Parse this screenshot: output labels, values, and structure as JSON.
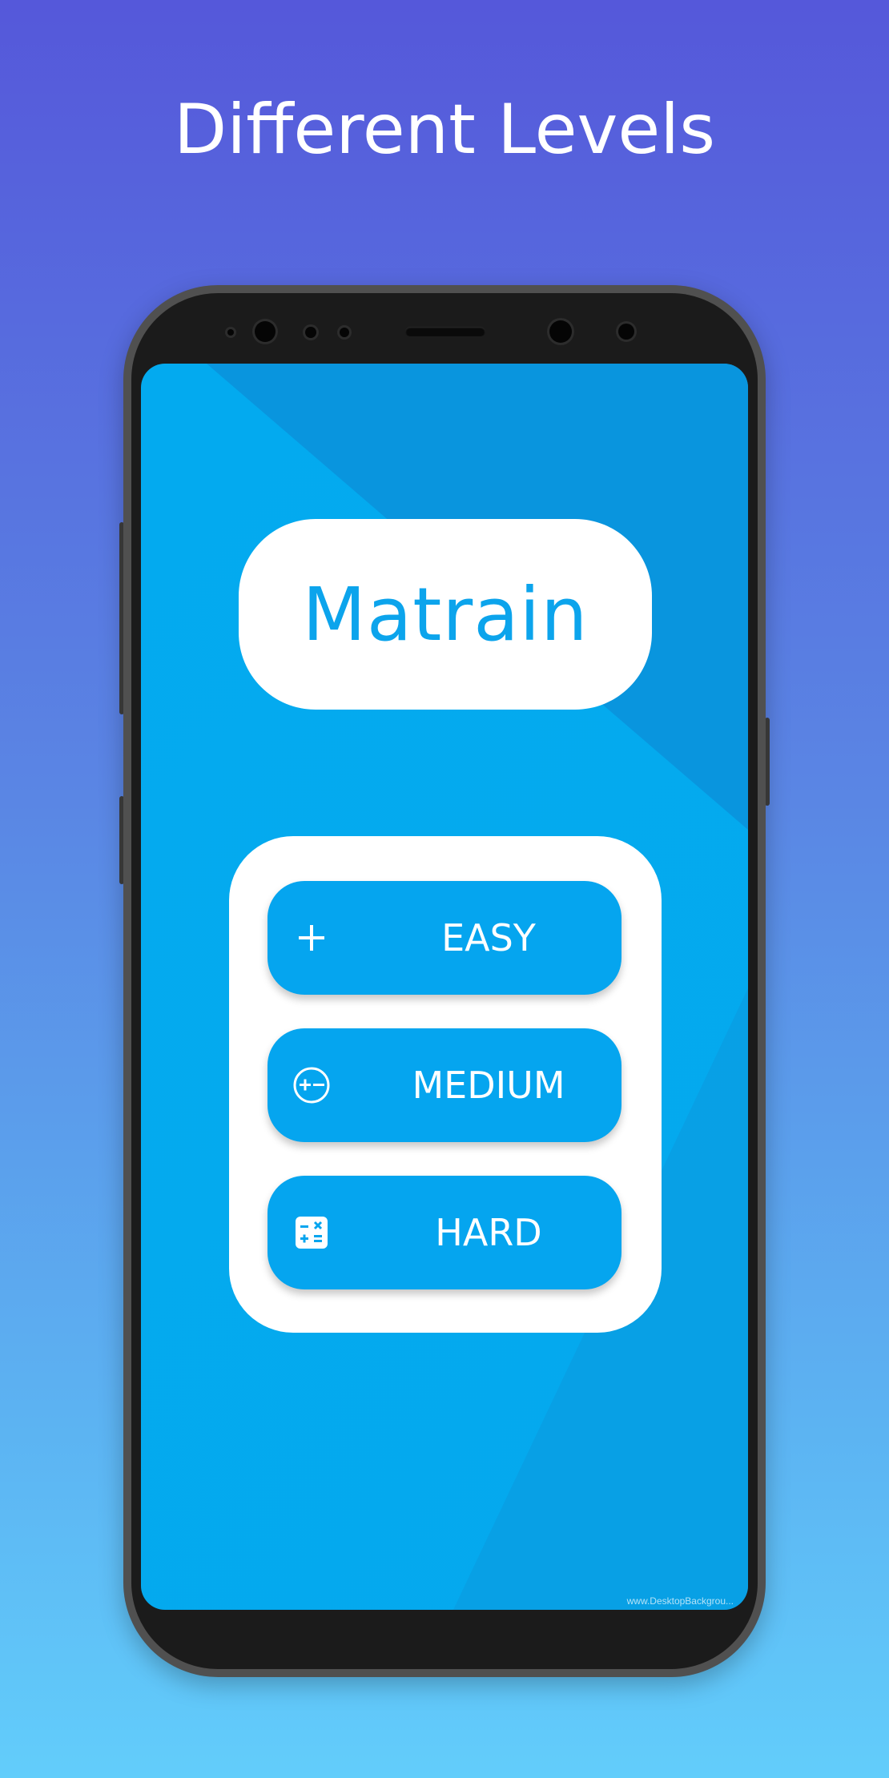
{
  "headline": "Different Levels",
  "app": {
    "name": "Matrain"
  },
  "levels": [
    {
      "label": "EASY",
      "icon": "plus-icon"
    },
    {
      "label": "MEDIUM",
      "icon": "plus-minus-circle-icon"
    },
    {
      "label": "HARD",
      "icon": "calculator-icon"
    }
  ],
  "watermark": "www.DesktopBackgrou...",
  "colors": {
    "background_top": "#5558DA",
    "background_bottom": "#62CDFB",
    "screen_blue": "#03AAEF",
    "button_blue": "#05A5EF",
    "logo_text": "#0CA4EC"
  }
}
